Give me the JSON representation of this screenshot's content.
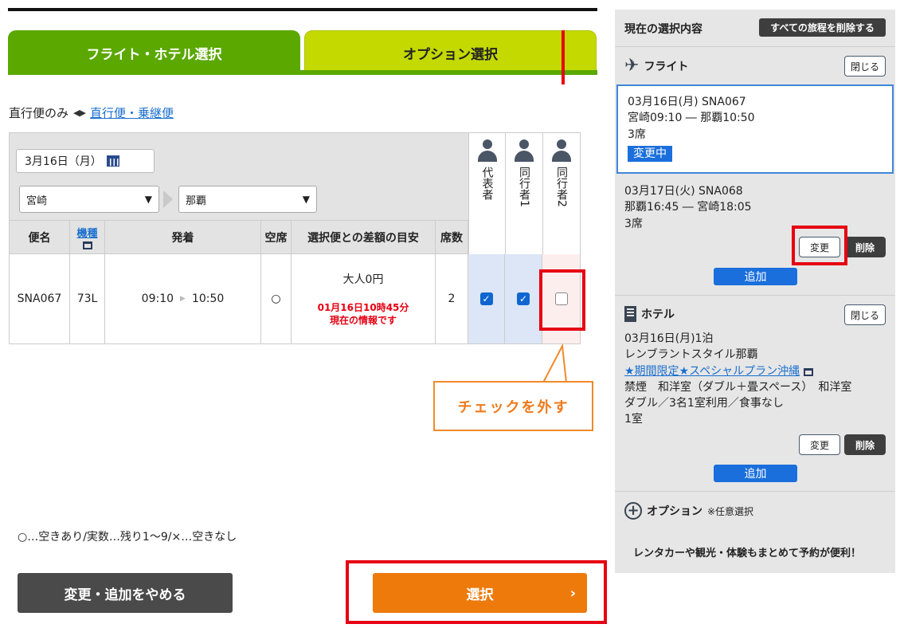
{
  "tabs": {
    "flight_hotel": "フライト・ホテル選択",
    "option": "オプション選択"
  },
  "direct": {
    "current": "直行便のみ",
    "arrows": "◀▶",
    "link": "直行便・乗継便"
  },
  "search": {
    "date": "3月16日（月）",
    "from": "宮崎",
    "to": "那覇"
  },
  "passengers": [
    "代表者",
    "同行者1",
    "同行者2"
  ],
  "table": {
    "headers": {
      "flight": "便名",
      "aircraft": "機種",
      "times": "発着",
      "seats_avail": "空席",
      "diff": "選択便との差額の目安",
      "seat_count": "席数"
    },
    "row": {
      "flight": "SNA067",
      "aircraft": "73L",
      "depart": "09:10",
      "arrive": "10:50",
      "seats_avail": "○",
      "price": "大人0円",
      "note_line1": "01月16日10時45分",
      "note_line2": "現在の情報です",
      "seat_count": "2"
    }
  },
  "callout": "チェックを外す",
  "legend": "○…空きあり/実数…残り1～9/×…空きなし",
  "buttons": {
    "cancel": "変更・追加をやめる",
    "select": "選択",
    "select_chevron": "›"
  },
  "sidebar": {
    "title": "現在の選択内容",
    "delete_all": "すべての旅程を削除する",
    "flight_label": "フライト",
    "close": "閉じる",
    "flight1": {
      "line1": "03月16日(月) SNA067",
      "line2": "宮崎09:10 ― 那覇10:50",
      "line3": "3席",
      "badge": "変更中"
    },
    "flight2": {
      "line1": "03月17日(火) SNA068",
      "line2": "那覇16:45 ― 宮崎18:05",
      "line3": "3席"
    },
    "change": "変更",
    "delete": "削除",
    "add": "追加",
    "hotel_label": "ホテル",
    "hotel": {
      "line1": "03月16日(月)1泊",
      "line2": "レンブラントスタイル那覇",
      "plan_link": "★期間限定★スペシャルプラン沖縄",
      "line3": "禁煙　和洋室（ダブル＋畳スペース）　和洋室",
      "line4": "ダブル／3名1室利用／食事なし",
      "line5": "1室"
    },
    "option_label": "オプション",
    "option_sub": "※任意選択",
    "promo": "レンタカーや観光・体験もまとめて予約が便利！"
  }
}
